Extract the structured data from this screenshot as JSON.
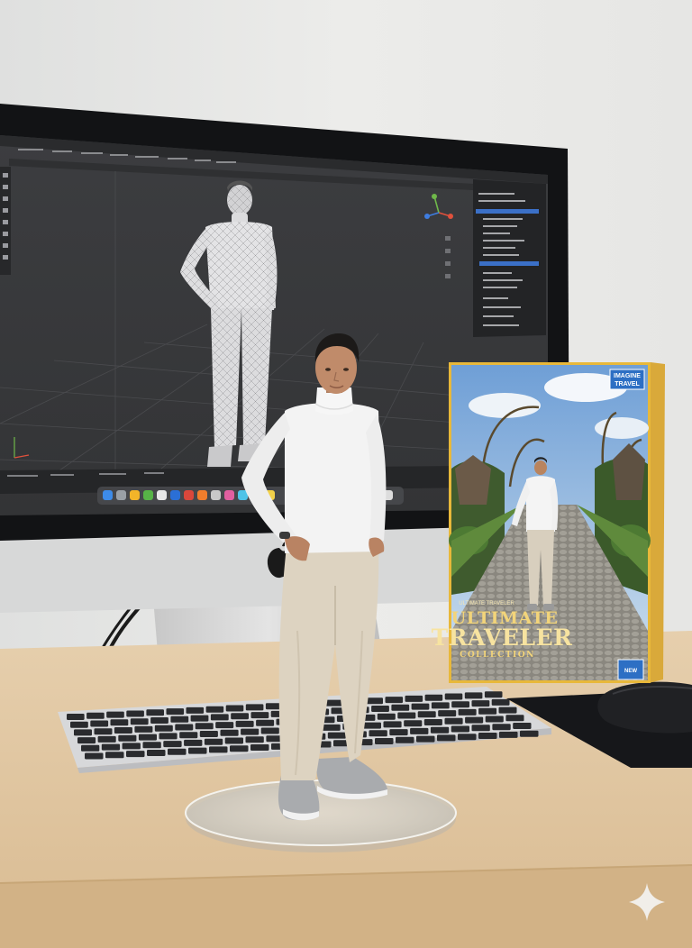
{
  "scene": {
    "description_free": true,
    "colors": {
      "wall": "#e9e9e7",
      "desk": "#e3c9a6",
      "monitor_bezel": "#111214",
      "viewport": "#3a3b3d",
      "box_frame": "#e8b83a",
      "box_accent_blue": "#2d6fc4",
      "figure_shirt": "#f3f3f3",
      "figure_pants": "#ddd3c1"
    },
    "icons": [
      "apple-logo-icon",
      "sparkle-icon"
    ]
  },
  "product_box": {
    "top_line": "ULTIMATE TRAVELER",
    "brand_badge_line1": "IMAGINE",
    "brand_badge_line2": "TRAVEL",
    "title_line1": "ULTIMATE",
    "title_line2": "TRAVELER",
    "subtitle": "COLLECTION",
    "corner_badge": "NEW"
  }
}
